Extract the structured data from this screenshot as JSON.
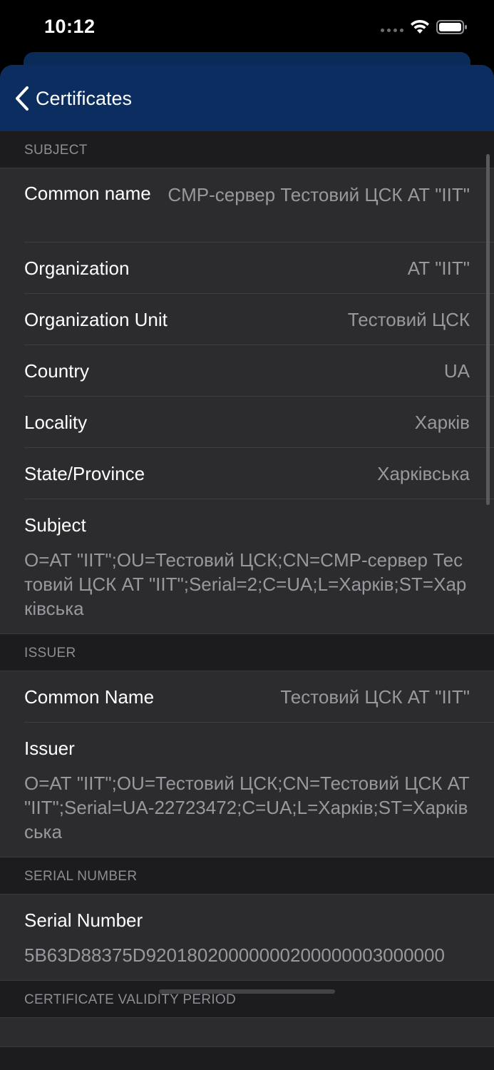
{
  "status_bar": {
    "time": "10:12"
  },
  "nav": {
    "back_label": "Certificates"
  },
  "sections": {
    "subject": {
      "header": "SUBJECT",
      "common_name": {
        "label": "Common name",
        "value": "CMP-сервер Тестовий ЦСК АТ \"IIT\""
      },
      "organization": {
        "label": "Organization",
        "value": "АТ \"IIT\""
      },
      "organization_unit": {
        "label": "Organization Unit",
        "value": "Тестовий ЦСК"
      },
      "country": {
        "label": "Country",
        "value": "UA"
      },
      "locality": {
        "label": "Locality",
        "value": "Харків"
      },
      "state": {
        "label": "State/Province",
        "value": "Харківська"
      },
      "subject": {
        "label": "Subject",
        "value": "O=АТ \"IIT\";OU=Тестовий ЦСК;CN=CMP-сервер Тестовий ЦСК АТ \"IIT\";Serial=2;C=UA;L=Харків;ST=Харківська"
      }
    },
    "issuer": {
      "header": "ISSUER",
      "common_name": {
        "label": "Common Name",
        "value": "Тестовий ЦСК АТ \"IIT\""
      },
      "issuer": {
        "label": "Issuer",
        "value": "O=АТ \"IIT\";OU=Тестовий ЦСК;CN=Тестовий ЦСК АТ \"IIT\";Serial=UA-22723472;C=UA;L=Харків;ST=Харківська"
      }
    },
    "serial": {
      "header": "SERIAL NUMBER",
      "serial_number": {
        "label": "Serial Number",
        "value": "5B63D88375D92018020000000200000003000000"
      }
    },
    "validity": {
      "header": "CERTIFICATE VALIDITY PERIOD"
    }
  }
}
